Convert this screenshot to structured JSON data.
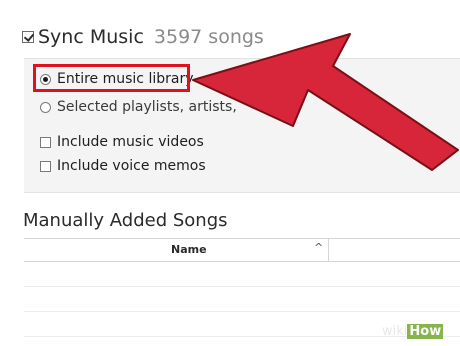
{
  "sync": {
    "title": "Sync Music",
    "count": "3597 songs",
    "checked": true
  },
  "options": {
    "entire_library": {
      "label": "Entire music library",
      "selected": true
    },
    "selected_playlists": {
      "label": "Selected playlists, artists,",
      "selected": false
    },
    "include_videos": {
      "label": "Include music videos",
      "checked": false
    },
    "include_memos": {
      "label": "Include voice memos",
      "checked": false
    }
  },
  "manual": {
    "title": "Manually Added Songs",
    "columns": [
      {
        "label": "Name",
        "sort_indicator": "^"
      }
    ]
  },
  "watermark": {
    "part1": "wiki",
    "part2": "How"
  },
  "colors": {
    "highlight": "#e0111f",
    "arrow": "#d7263a",
    "watermark_bg": "#87b44b"
  }
}
